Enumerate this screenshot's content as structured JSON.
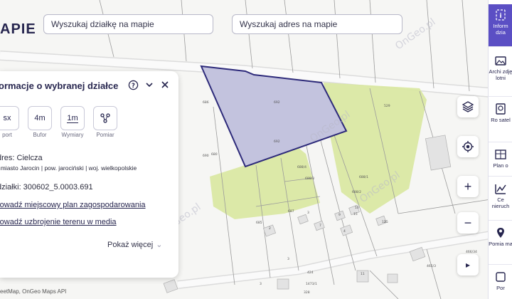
{
  "header": {
    "brand": "APIE",
    "search_plot_placeholder": "Wyszukaj działkę na mapie",
    "search_address_placeholder": "Wyszukaj adres na mapie"
  },
  "panel": {
    "title": "ormacje o wybranej działce",
    "tools": [
      {
        "name": "report",
        "box": "sx",
        "label": "port"
      },
      {
        "name": "buffer",
        "box": "4m",
        "label": "Bufor"
      },
      {
        "name": "dimensions",
        "box": "1m",
        "label": "Wymiary"
      },
      {
        "name": "measure",
        "box": "",
        "label": "Pomiar"
      }
    ],
    "address": "dres: Cielcza",
    "location": ", miasto Jarocin | pow. jarociński | woj. wielkopolskie",
    "plot_id": "działki: 300602_5.0003.691",
    "link_plan": "rowadź miejscowy plan zagospodarowania",
    "link_utilities": "rowadź uzbrojenie terenu w media",
    "show_more": "Pokaż więcej"
  },
  "rail": [
    {
      "label": "Inform dzia",
      "icon": "info-icon",
      "active": true
    },
    {
      "label": "Archi zdję lotni",
      "icon": "archive-photos-icon",
      "active": false
    },
    {
      "label": "Ro satel",
      "icon": "satellite-icon",
      "active": false
    },
    {
      "label": "Plan o",
      "icon": "plan-icon",
      "active": false
    },
    {
      "label": "Ce nieruch",
      "icon": "price-chart-icon",
      "active": false
    },
    {
      "label": "Pomia ma",
      "icon": "measure-map-icon",
      "active": false
    },
    {
      "label": "Por",
      "icon": "compare-icon",
      "active": false
    }
  ],
  "map": {
    "watermark": "OnGeo.pl",
    "attribution": "eetMap, OnGeo Maps API",
    "parcel_labels": [
      "692",
      "692",
      "686",
      "680",
      "688/4",
      "688/3",
      "688/2",
      "688/1",
      "687",
      "685",
      "15",
      "11",
      "15",
      "2",
      "3",
      "7",
      "4",
      "9",
      "10",
      "12",
      "465/3",
      "466/34",
      "484/4",
      "424",
      "529",
      "3",
      "3",
      "328",
      "690",
      "1473/1"
    ],
    "selected_color": "#c3c3de",
    "selected_border": "#2d2a7a",
    "green_color": "#d9e8a0"
  },
  "controls": {
    "layers": "layers-icon",
    "locate": "locate-icon",
    "zoom_in": "+",
    "zoom_out": "−",
    "expand": "▸"
  }
}
